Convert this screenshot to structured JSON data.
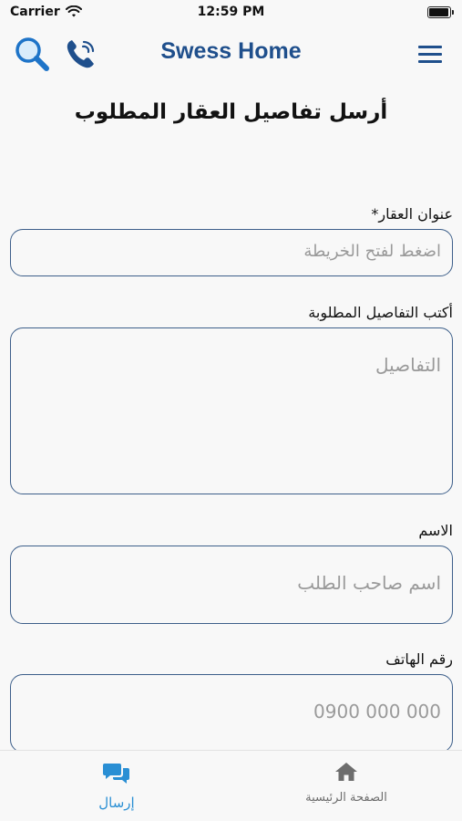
{
  "status": {
    "carrier": "Carrier",
    "time": "12:59 PM",
    "battery_level": 1.0
  },
  "header": {
    "title": "Swess Home",
    "icons": [
      "search-icon",
      "phone-icon",
      "menu-icon"
    ]
  },
  "page": {
    "title": "أرسل تفاصيل العقار المطلوب"
  },
  "form": {
    "address": {
      "label": "عنوان العقار*",
      "placeholder": "اضغط لفتح الخريطة"
    },
    "details": {
      "label": "أكتب التفاصيل المطلوبة",
      "placeholder": "التفاصيل"
    },
    "name": {
      "label": "الاسم",
      "placeholder": "اسم صاحب الطلب"
    },
    "phone": {
      "label": "رقم الهاتف",
      "placeholder": "0900 000 000"
    }
  },
  "tabs": [
    {
      "label": "إرسال",
      "icon": "chat-icon",
      "active": true
    },
    {
      "label": "الصفحة الرئيسية",
      "icon": "home-icon",
      "active": false
    }
  ],
  "colors": {
    "brand": "#1f4f8c",
    "accent": "#2a8fd4",
    "border": "#3d5f8a"
  }
}
